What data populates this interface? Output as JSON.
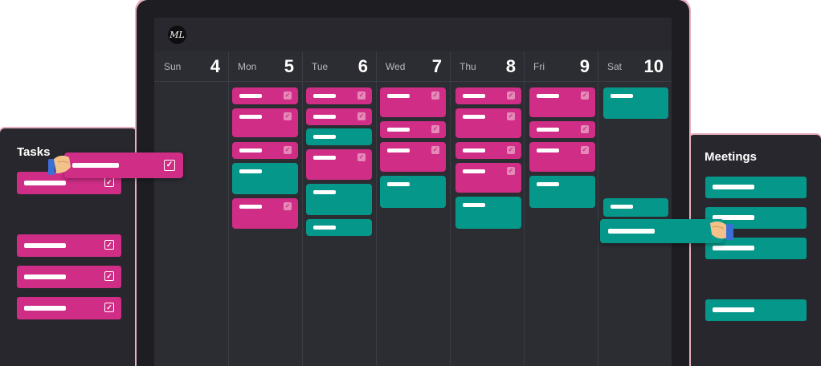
{
  "app": {
    "logo_text": "ML"
  },
  "days": [
    {
      "name": "Sun",
      "num": "4"
    },
    {
      "name": "Mon",
      "num": "5"
    },
    {
      "name": "Tue",
      "num": "6"
    },
    {
      "name": "Wed",
      "num": "7"
    },
    {
      "name": "Thu",
      "num": "8"
    },
    {
      "name": "Fri",
      "num": "9"
    },
    {
      "name": "Sat",
      "num": "10"
    }
  ],
  "tasks_panel": {
    "title": "Tasks"
  },
  "meetings_panel": {
    "title": "Meetings"
  },
  "colors": {
    "task": "#cf2d86",
    "meeting": "#05988a",
    "screen": "#2c2c33",
    "bezel": "#1e1e22"
  }
}
